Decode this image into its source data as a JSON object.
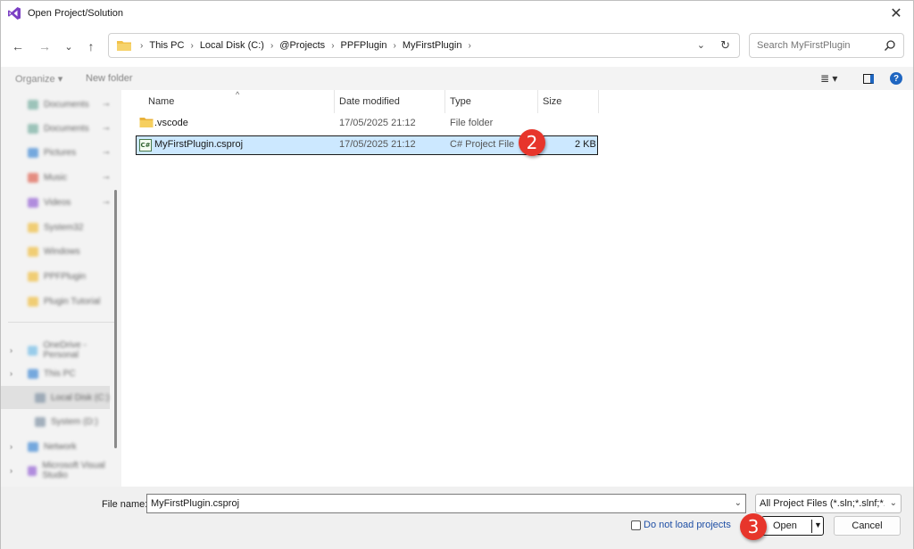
{
  "window": {
    "title": "Open Project/Solution",
    "close_glyph": "✕"
  },
  "nav": {
    "back_glyph": "←",
    "forward_glyph": "→",
    "recent_glyph": "⌄",
    "up_glyph": "↑"
  },
  "address": {
    "crumbs": [
      "This PC",
      "Local Disk (C:)",
      "@Projects",
      "PPFPlugin",
      "MyFirstPlugin"
    ],
    "separator": "›",
    "dropdown_glyph": "⌄",
    "refresh_glyph": "↻"
  },
  "search": {
    "placeholder": "Search MyFirstPlugin"
  },
  "toolbar": {
    "organize_label": "Organize ▾",
    "new_folder_label": "New folder",
    "view_glyph": "≣ ▾",
    "help_glyph": "?"
  },
  "sidebar": {
    "items": [
      {
        "label": "Documents",
        "color": "#7fb3a6"
      },
      {
        "label": "Documents",
        "color": "#7fb3a6"
      },
      {
        "label": "Pictures",
        "color": "#4a8fd6"
      },
      {
        "label": "Music",
        "color": "#e06a5a"
      },
      {
        "label": "Videos",
        "color": "#9a6ad6"
      },
      {
        "label": "System32",
        "color": "#f0c14a"
      },
      {
        "label": "Windows",
        "color": "#f0c14a"
      },
      {
        "label": "PPFPlugin",
        "color": "#f0c14a"
      },
      {
        "label": "Plugin Tutorial",
        "color": "#f0c14a"
      },
      {
        "label": "OneDrive - Personal",
        "color": "#7cc0e8"
      },
      {
        "label": "This PC",
        "color": "#4a8fd6"
      },
      {
        "label": "Local Disk (C:)",
        "color": "#8899aa"
      },
      {
        "label": "System (D:)",
        "color": "#8899aa"
      },
      {
        "label": "Network",
        "color": "#4a8fd6"
      },
      {
        "label": "Microsoft Visual Studio",
        "color": "#9a6ad6"
      }
    ]
  },
  "columns": {
    "name": "Name",
    "date": "Date modified",
    "type": "Type",
    "size": "Size",
    "sort_glyph": "^"
  },
  "files": [
    {
      "name": ".vscode",
      "date": "17/05/2025 21:12",
      "type": "File folder",
      "size": "",
      "icon": "folder-icon"
    },
    {
      "name": "MyFirstPlugin.csproj",
      "date": "17/05/2025 21:12",
      "type": "C# Project File",
      "size": "2 KB",
      "icon": "csproj-icon",
      "icon_text": "C#"
    }
  ],
  "badges": {
    "step2": "2",
    "step3": "3"
  },
  "footer": {
    "file_name_label": "File name:",
    "file_name_value": "MyFirstPlugin.csproj",
    "filter_value": "All Project Files (*.sln;*.slnf;*.csproj",
    "dropdown_glyph": "⌄",
    "do_not_load_label": "Do not load projects",
    "open_label": "Open",
    "open_dd_glyph": "▼",
    "cancel_label": "Cancel"
  },
  "colors": {
    "accent": "#1f66c1",
    "selection": "#cce8ff",
    "badge": "#e7352b"
  }
}
